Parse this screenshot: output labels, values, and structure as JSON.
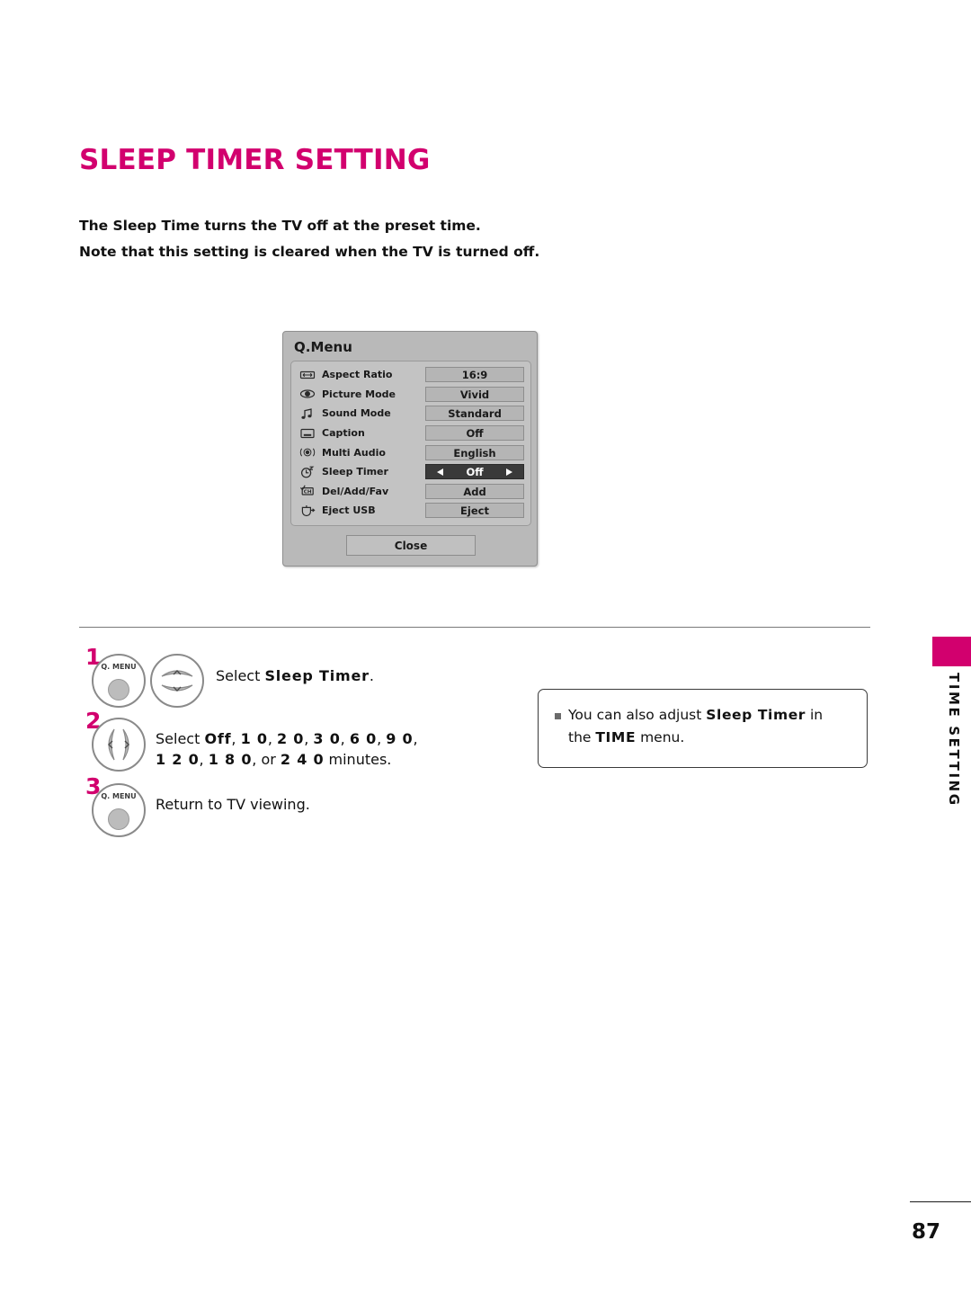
{
  "page": {
    "title": "SLEEP TIMER SETTING",
    "intro_line_1": "The Sleep Time turns the TV off at the preset time.",
    "intro_line_2": "Note that this setting is cleared when the TV is turned off.",
    "number": "87",
    "accent_color": "#d2006e"
  },
  "side_tab": {
    "label": "TIME SETTING"
  },
  "qmenu": {
    "title": "Q.Menu",
    "close_label": "Close",
    "rows": [
      {
        "icon": "aspect-ratio-icon",
        "label": "Aspect Ratio",
        "value": "16:9",
        "selected": false
      },
      {
        "icon": "picture-mode-icon",
        "label": "Picture Mode",
        "value": "Vivid",
        "selected": false
      },
      {
        "icon": "sound-mode-icon",
        "label": "Sound Mode",
        "value": "Standard",
        "selected": false
      },
      {
        "icon": "caption-icon",
        "label": "Caption",
        "value": "Off",
        "selected": false
      },
      {
        "icon": "multi-audio-icon",
        "label": "Multi Audio",
        "value": "English",
        "selected": false
      },
      {
        "icon": "sleep-timer-icon",
        "label": "Sleep Timer",
        "value": "Off",
        "selected": true
      },
      {
        "icon": "del-add-fav-icon",
        "label": "Del/Add/Fav",
        "value": "Add",
        "selected": false
      },
      {
        "icon": "eject-usb-icon",
        "label": "Eject USB",
        "value": "Eject",
        "selected": false
      }
    ]
  },
  "steps": [
    {
      "number": "1",
      "button_label": "Q. MENU",
      "text_html": "Select <b>Sleep Timer</b>."
    },
    {
      "number": "2",
      "text_html": "Select <b>Off</b>, <b>1 0</b>, <b>2 0</b>, <b>3 0</b>, <b>6 0</b>, <b>9 0</b>,<br><b>1 2 0</b>, <b>1 8 0</b>, or <b>2 4 0</b> minutes."
    },
    {
      "number": "3",
      "button_label": "Q. MENU",
      "text_html": "Return to TV viewing."
    }
  ],
  "note": {
    "text_html": "You can also adjust <b>Sleep Timer</b> in<br>the <b>TIME</b> menu."
  }
}
